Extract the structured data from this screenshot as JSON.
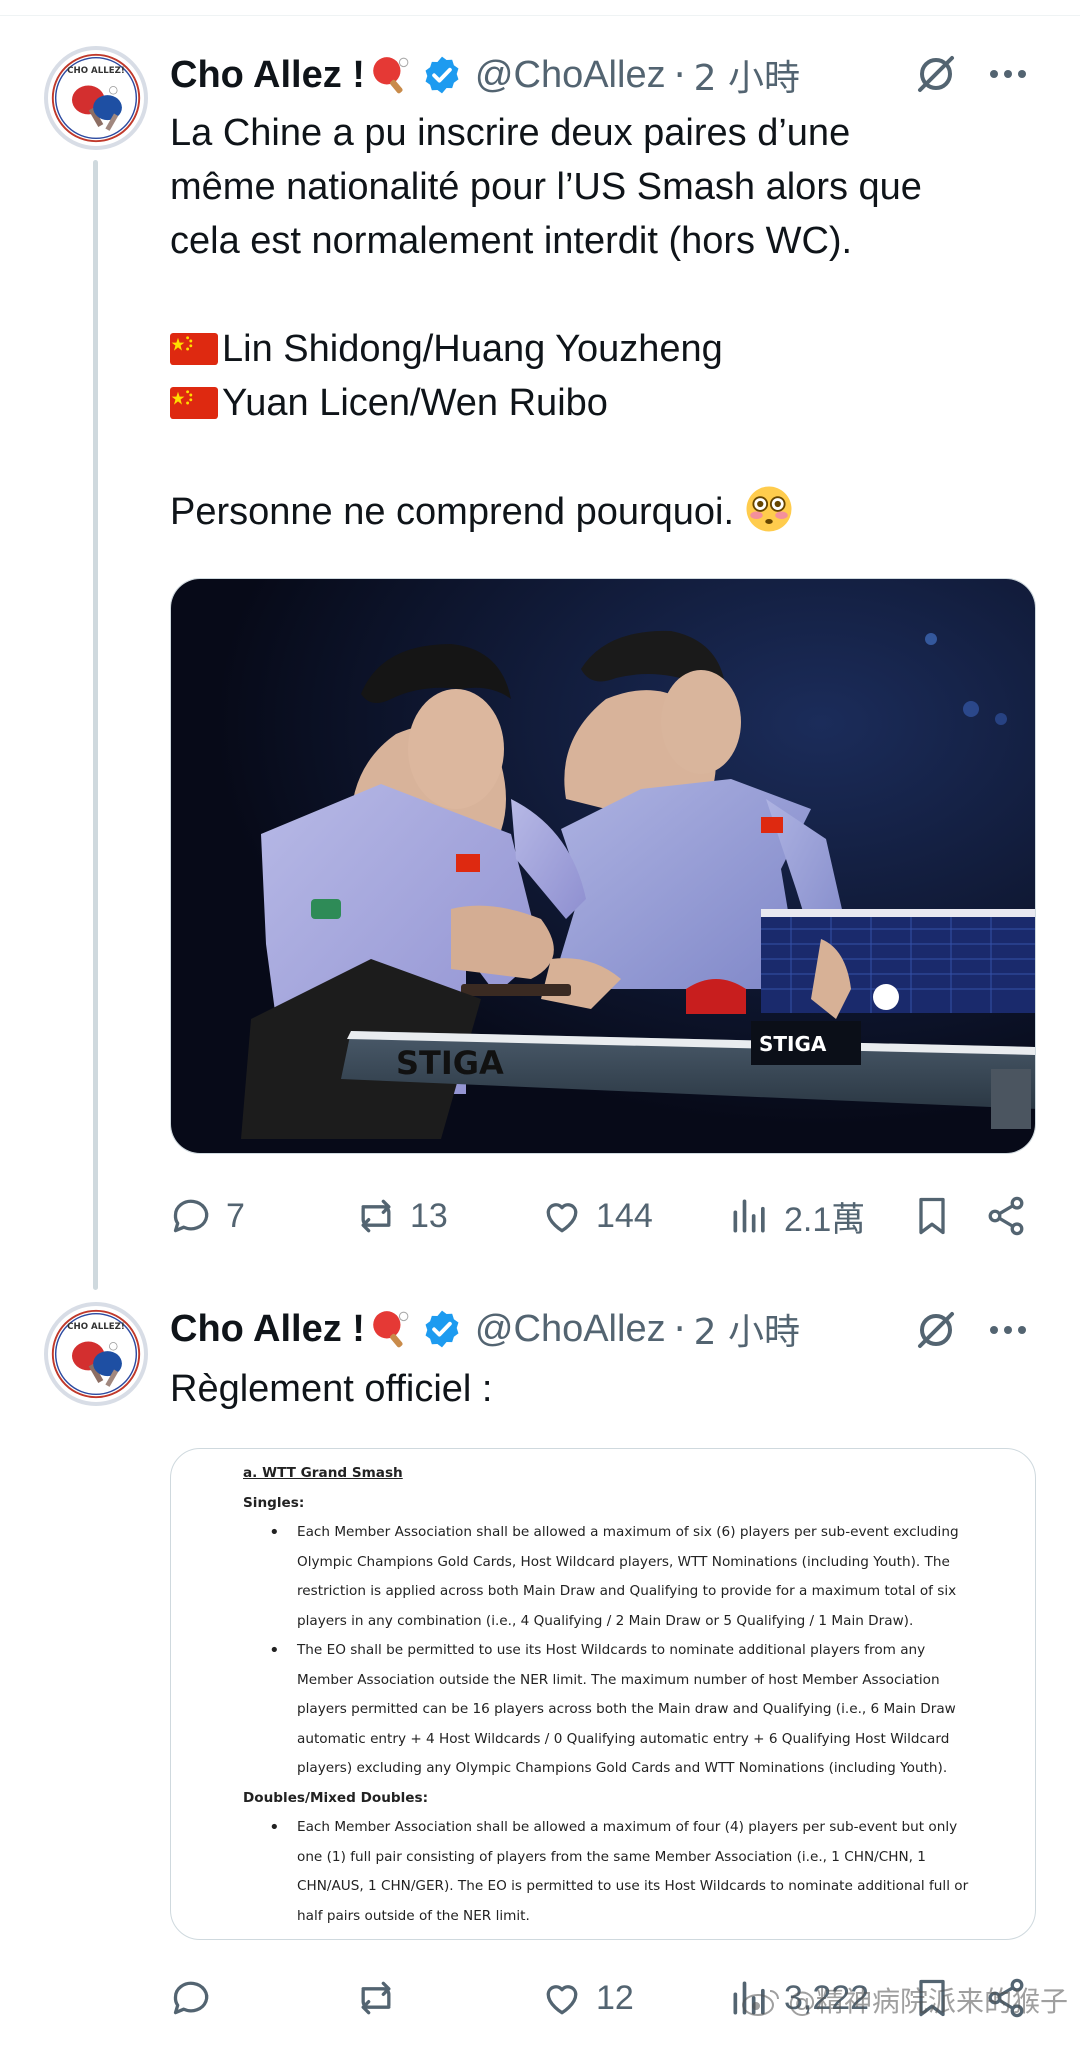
{
  "tweets": [
    {
      "author": {
        "display_name": "Cho Allez !",
        "handle": "@ChoAllez",
        "separator": "·",
        "time": "2 小時"
      },
      "text": {
        "line1": "La Chine a pu inscrire deux paires d’une",
        "line2": "même nationalité pour l’US Smash alors que",
        "line3": "cela est normalement interdit (hors WC).",
        "pair1": "Lin Shidong/Huang Youzheng",
        "pair2": "Yuan Licen/Wen Ruibo",
        "closing": "Personne ne comprend pourquoi."
      },
      "media_labels": {
        "table_brand": "STIGA",
        "net_brand": "STIGA"
      },
      "actions": {
        "replies": "7",
        "retweets": "13",
        "likes": "144",
        "views": "2.1萬"
      }
    },
    {
      "author": {
        "display_name": "Cho Allez !",
        "handle": "@ChoAllez",
        "separator": "·",
        "time": "2 小時"
      },
      "text": {
        "line1": "Règlement officiel :"
      },
      "document": {
        "heading": "a. WTT Grand Smash",
        "singles_label": "Singles:",
        "singles_items": [
          [
            "Each Member Association shall be allowed a maximum of six (6) players per sub-event excluding",
            "Olympic Champions Gold Cards, Host Wildcard players, WTT Nominations (including Youth). The",
            "restriction is applied across both Main Draw and Qualifying to provide for a maximum total of six",
            "players in any combination (i.e., 4 Qualifying / 2 Main Draw or 5 Qualifying / 1 Main Draw)."
          ],
          [
            "The EO shall be permitted to use its Host Wildcards to nominate additional players from any",
            "Member Association outside the NER limit. The maximum number of host Member Association",
            "players permitted can be 16 players across both the Main draw and Qualifying (i.e., 6 Main Draw",
            "automatic entry + 4 Host Wildcards / 0 Qualifying automatic entry + 6 Qualifying Host Wildcard",
            "players) excluding any Olympic Champions Gold Cards and WTT Nominations (including Youth)."
          ]
        ],
        "doubles_label": "Doubles/Mixed Doubles:",
        "doubles_items": [
          [
            "Each Member Association shall be allowed a maximum of four (4) players per sub-event but only",
            "one (1) full pair consisting of players from the same Member Association (i.e., 1 CHN/CHN, 1",
            "CHN/AUS, 1 CHN/GER). The EO is permitted to use its Host Wildcards to nominate additional full or",
            "half pairs outside of the NER limit."
          ]
        ]
      },
      "actions": {
        "replies": "",
        "retweets": "",
        "likes": "12",
        "views": "3,222"
      }
    }
  ],
  "watermark": "@精神病院派来的猴子",
  "icons": [
    "avatar-logo",
    "paddle-emoji",
    "verified-badge",
    "grok-icon",
    "more-icon",
    "china-flag",
    "flushed-face-emoji",
    "reply-icon",
    "retweet-icon",
    "like-icon",
    "views-icon",
    "bookmark-icon",
    "share-icon",
    "weibo-logo"
  ],
  "colors": {
    "text": "#0f1419",
    "secondary": "#536471",
    "verified": "#1d9bf0",
    "thread_line": "#cfd9de"
  }
}
